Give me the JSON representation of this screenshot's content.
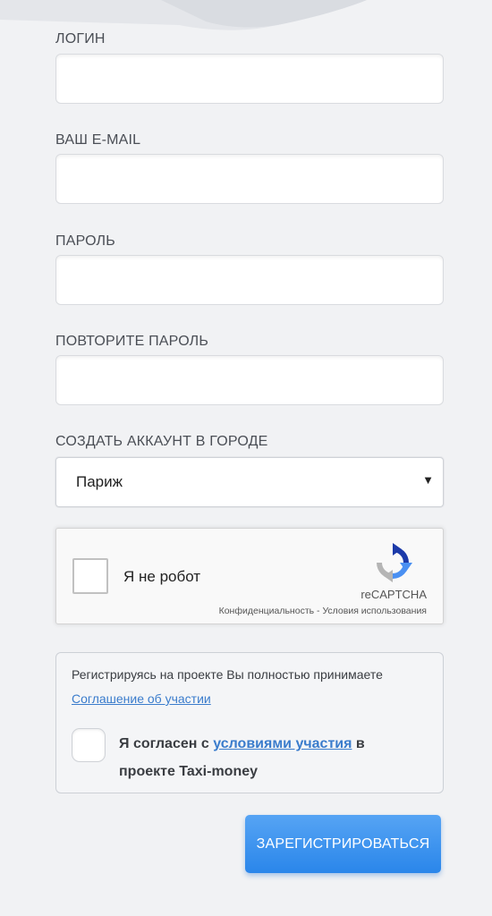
{
  "fields": {
    "login_label": "ЛОГИН",
    "email_label": "ВАШ E-MAIL",
    "password_label": "ПАРОЛЬ",
    "repeat_password_label": "ПОВТОРИТЕ ПАРОЛЬ",
    "city_label": "СОЗДАТЬ АККАУНТ В ГОРОДЕ",
    "city_value": "Париж"
  },
  "captcha": {
    "checkbox_label": "Я не робот",
    "brand": "reCAPTCHA",
    "privacy": "Конфиденциальность",
    "separator": " - ",
    "terms": "Условия использования"
  },
  "agreement": {
    "text": "Регистрируясь на проекте Вы полностью принимаете",
    "link": "Соглашение об участии",
    "consent_prefix": "Я согласен с ",
    "consent_link": "условиями участия",
    "consent_suffix": " в проекте Taxi-money"
  },
  "submit_label": "ЗАРЕГИСТРИРОВАТЬСЯ",
  "colors": {
    "accent": "#3a7ccc",
    "button": "#2a86ea",
    "background": "#f1f2f4"
  },
  "icons": {
    "select_arrow": "▼",
    "captcha_logo": "recaptcha-logo-icon"
  }
}
